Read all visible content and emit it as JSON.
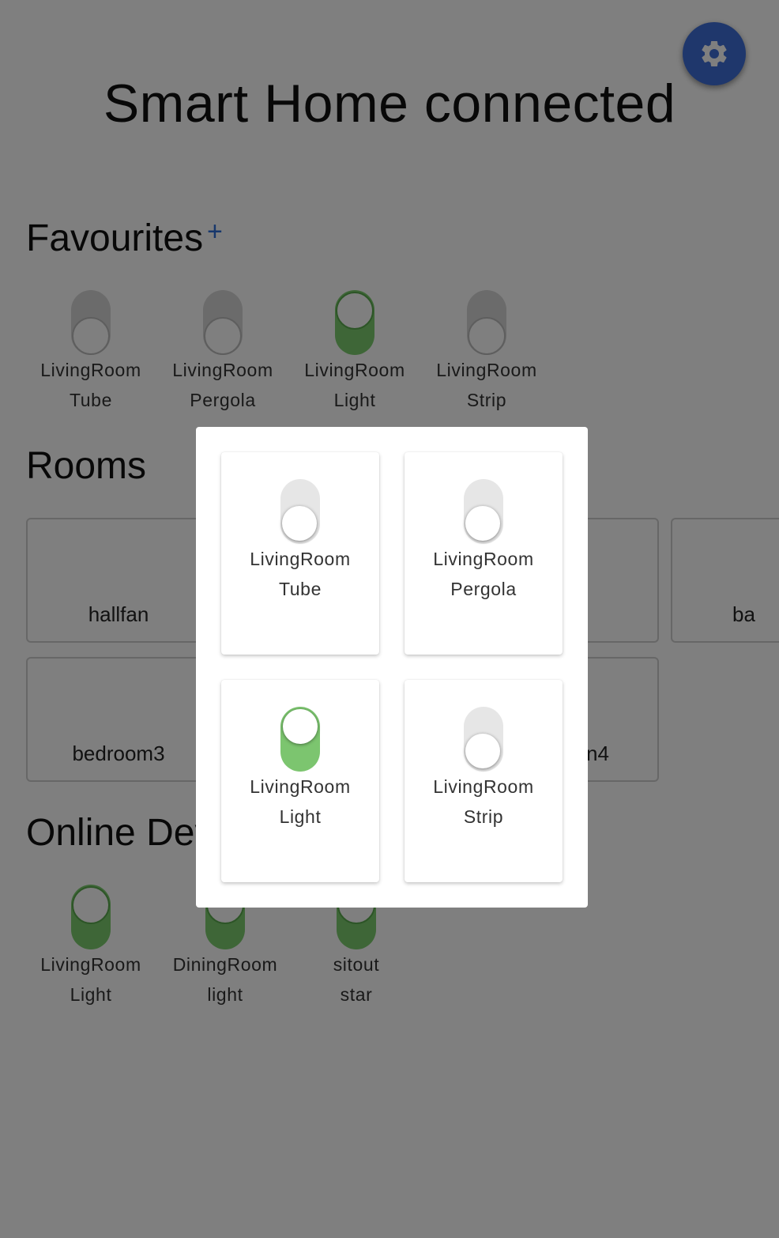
{
  "app": {
    "title": "Smart Home connected"
  },
  "settings_button": {
    "icon": "gear-icon",
    "color": "#3f6fd8"
  },
  "favourites": {
    "title": "Favourites",
    "add_symbol": "+",
    "devices": [
      {
        "line1": "LivingRoom",
        "line2": "Tube",
        "on": false
      },
      {
        "line1": "LivingRoom",
        "line2": "Pergola",
        "on": false
      },
      {
        "line1": "LivingRoom",
        "line2": "Light",
        "on": true
      },
      {
        "line1": "LivingRoom",
        "line2": "Strip",
        "on": false
      }
    ]
  },
  "rooms": {
    "title": "Rooms",
    "items": [
      "hallfan",
      "ba",
      "bedroom3",
      "n4"
    ]
  },
  "online_devices": {
    "title": "Online Dev",
    "devices": [
      {
        "line1": "LivingRoom",
        "line2": "Light",
        "on": true
      },
      {
        "line1": "DiningRoom",
        "line2": "light",
        "on": true
      },
      {
        "line1": "sitout",
        "line2": "star",
        "on": true
      }
    ]
  },
  "modal": {
    "devices": [
      {
        "line1": "LivingRoom",
        "line2": "Tube",
        "on": false
      },
      {
        "line1": "LivingRoom",
        "line2": "Pergola",
        "on": false
      },
      {
        "line1": "LivingRoom",
        "line2": "Light",
        "on": true
      },
      {
        "line1": "LivingRoom",
        "line2": "Strip",
        "on": false
      }
    ]
  },
  "colors": {
    "toggle_on": "#7ccd6f",
    "toggle_off": "#d6d6d6",
    "accent": "#2f6fd8"
  }
}
